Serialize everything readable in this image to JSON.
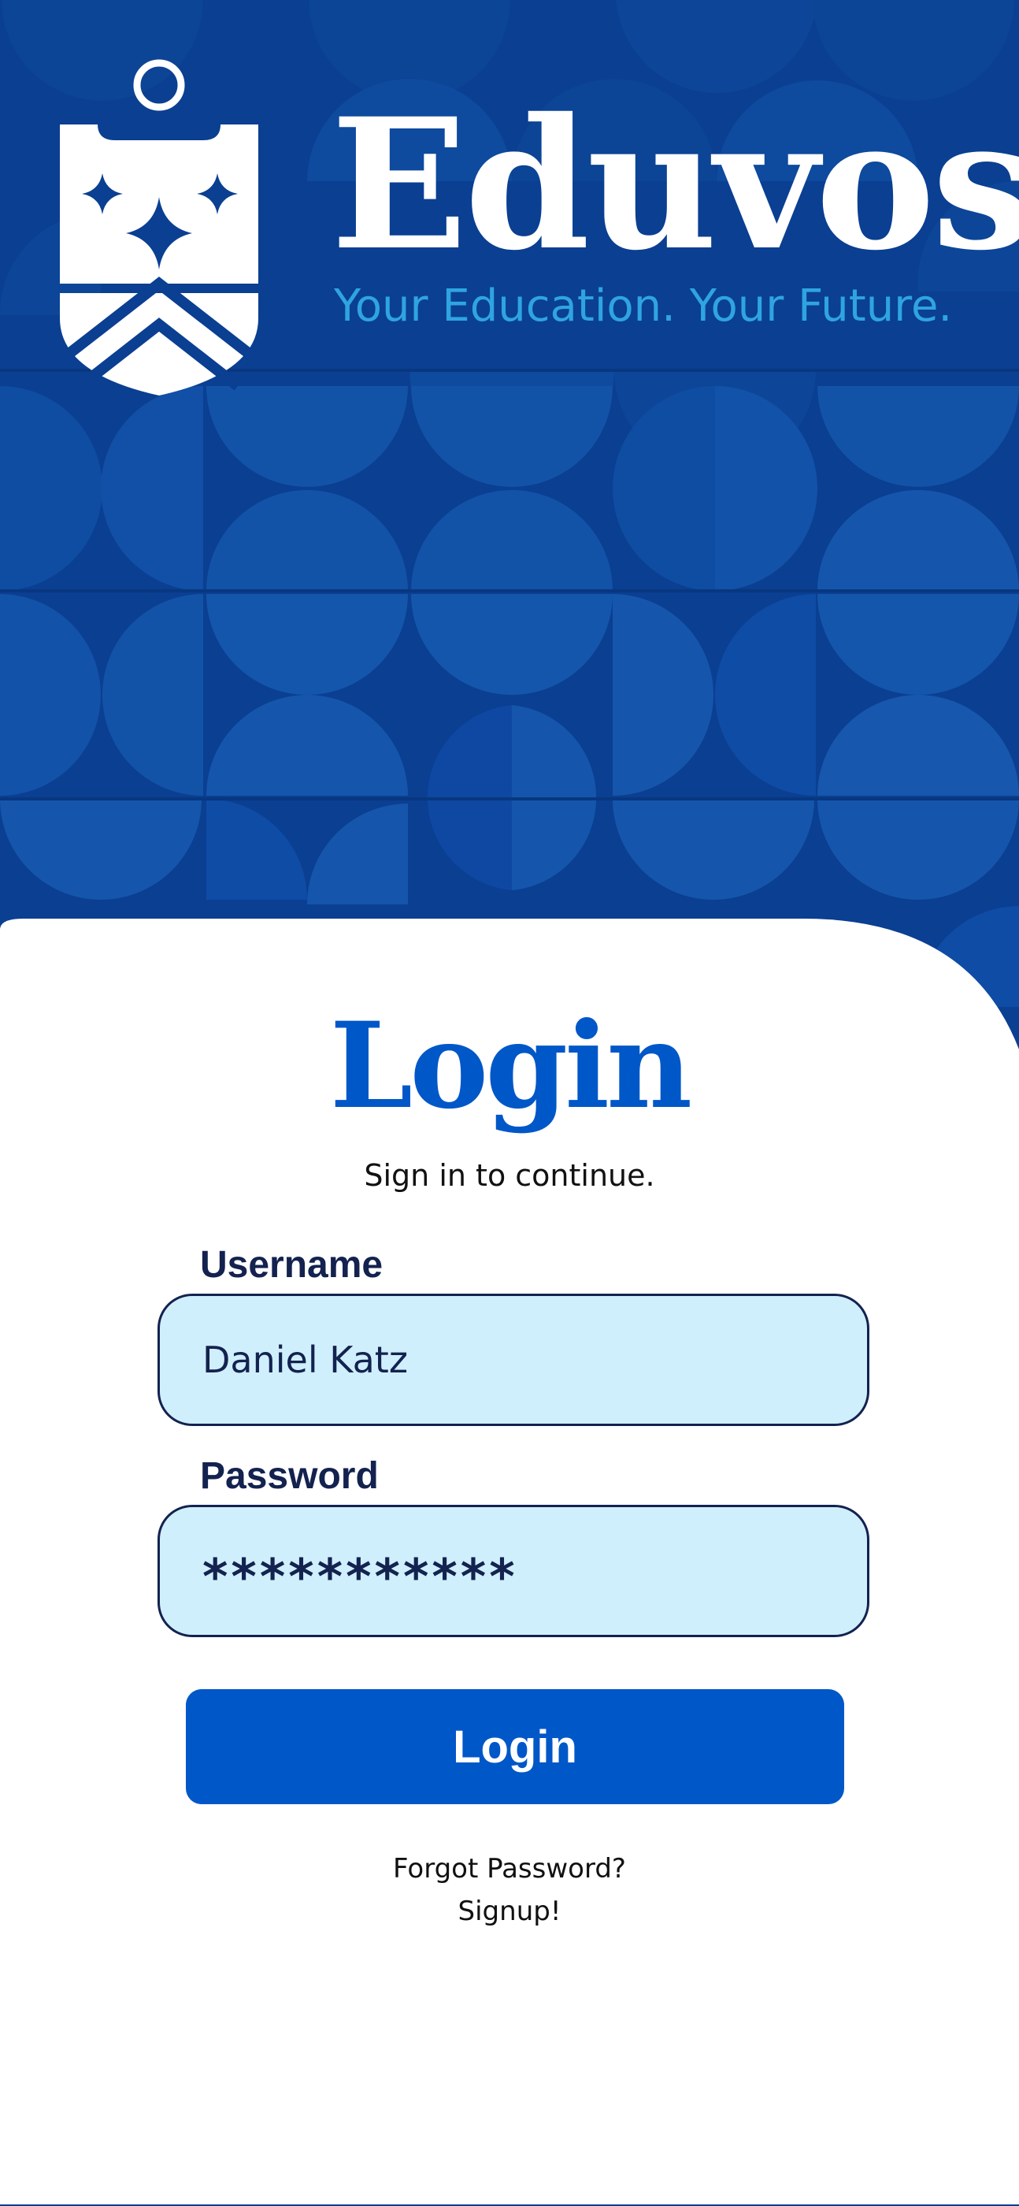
{
  "brand": {
    "name": "Eduvos",
    "tagline": "Your Education. Your Future.",
    "logo_icon": "shield-crest-icon"
  },
  "login": {
    "title": "Login",
    "subtitle": "Sign in to continue."
  },
  "form": {
    "username_label": "Username",
    "username_value": "Daniel Katz",
    "password_label": "Password",
    "password_value": "***********",
    "submit_label": "Login"
  },
  "links": {
    "forgot_password": "Forgot Password?",
    "signup": "Signup!"
  },
  "colors": {
    "hero_background": "#0a3f92",
    "primary": "#0057c8",
    "tagline": "#2fa4e0",
    "field_background": "#d0effc",
    "field_text": "#13224f"
  }
}
